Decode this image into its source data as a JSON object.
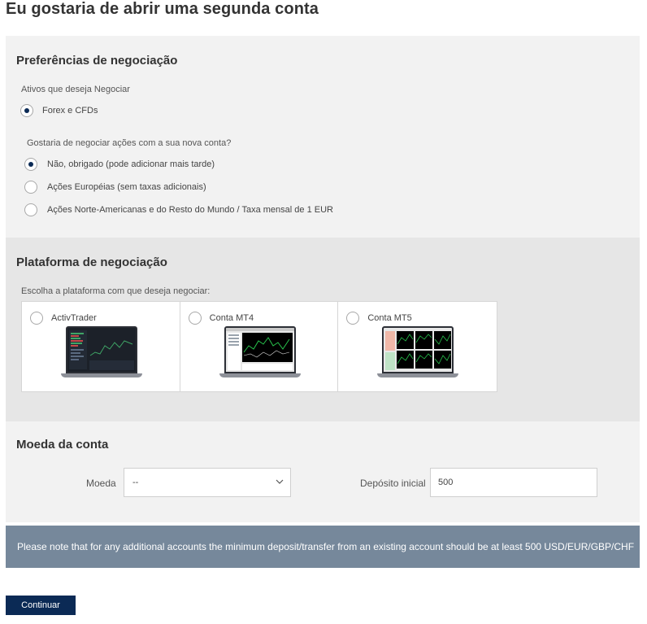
{
  "page": {
    "title": "Eu gostaria de abrir uma segunda conta"
  },
  "preferences": {
    "title": "Preferências de negociação",
    "assets_label": "Ativos que deseja Negociar",
    "assets_option": "Forex e CFDs",
    "stocks_question": "Gostaria de negociar ações com a sua nova conta?",
    "stocks_options": [
      "Não, obrigado (pode adicionar mais tarde)",
      "Ações Européias (sem taxas adicionais)",
      "Ações Norte-Americanas e do Resto do Mundo / Taxa mensal de 1 EUR"
    ],
    "stocks_selected_index": 0
  },
  "platform": {
    "title": "Plataforma de negociação",
    "choose_label": "Escolha a plataforma com que deseja negociar:",
    "options": [
      "ActivTrader",
      "Conta MT4",
      "Conta MT5"
    ],
    "selected_index": null
  },
  "currency": {
    "title": "Moeda da conta",
    "currency_label": "Moeda",
    "currency_value": "--",
    "deposit_label": "Depósito inicial",
    "deposit_value": "500"
  },
  "notice": {
    "text": "Please note that for any additional accounts the minimum deposit/transfer from an existing account should be at least 500 USD/EUR/GBP/CHF"
  },
  "actions": {
    "continue_label": "Continuar"
  },
  "colors": {
    "primary_navy": "#0b2a55",
    "notice_bg": "#76889b",
    "panel_light": "#f2f2f2",
    "panel_mid": "#e6e6e6"
  }
}
